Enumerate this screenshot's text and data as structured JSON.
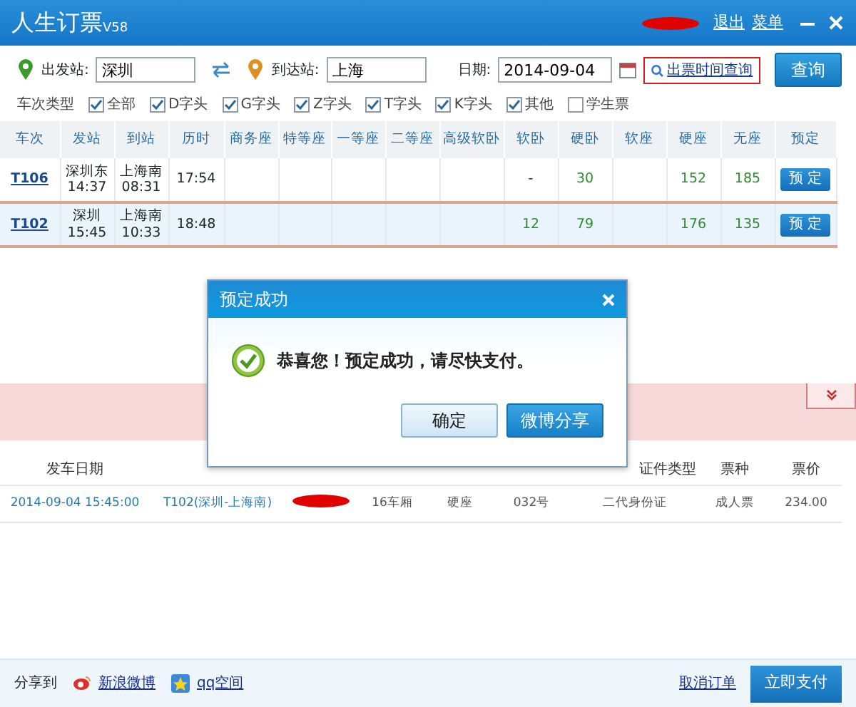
{
  "window": {
    "title": "人生订票",
    "version": "V58",
    "user_redacted": true,
    "links": [
      "退出",
      "菜单"
    ]
  },
  "search": {
    "from_label": "出发站:",
    "from_value": "深圳",
    "to_label": "到达站:",
    "to_value": "上海",
    "date_label": "日期:",
    "date_value": "2014-09-04",
    "time_link": "出票时间查询",
    "button": "查询"
  },
  "filters": {
    "label": "车次类型",
    "items": [
      {
        "label": "全部",
        "checked": true
      },
      {
        "label": "D字头",
        "checked": true
      },
      {
        "label": "G字头",
        "checked": true
      },
      {
        "label": "Z字头",
        "checked": true
      },
      {
        "label": "T字头",
        "checked": true
      },
      {
        "label": "K字头",
        "checked": true
      },
      {
        "label": "其他",
        "checked": true
      },
      {
        "label": "学生票",
        "checked": false
      }
    ]
  },
  "trains": {
    "columns": [
      "车次",
      "发站",
      "到站",
      "历时",
      "商务座",
      "特等座",
      "一等座",
      "二等座",
      "高级软卧",
      "软卧",
      "硬卧",
      "软座",
      "硬座",
      "无座",
      "预定"
    ],
    "rows": [
      {
        "train": "T106",
        "from": "深圳东",
        "depart": "14:37",
        "to": "上海南",
        "arrive": "08:31",
        "duration": "17:54",
        "seats": {
          "soft_sleeper": "-",
          "hard_sleeper": "30",
          "hard_seat": "152",
          "no_seat": "185"
        },
        "book": "预 定",
        "selected": false
      },
      {
        "train": "T102",
        "from": "深圳",
        "depart": "15:45",
        "to": "上海南",
        "arrive": "10:33",
        "duration": "18:48",
        "seats": {
          "soft_sleeper": "12",
          "hard_sleeper": "79",
          "hard_seat": "176",
          "no_seat": "135"
        },
        "book": "预 定",
        "selected": true
      }
    ]
  },
  "orders": {
    "columns": {
      "departure_date": "发车日期",
      "id_type": "证件类型",
      "ticket_type": "票种",
      "price": "票价"
    },
    "rows": [
      {
        "departure_date": "2014-09-04 15:45:00",
        "train": "T102(深圳-上海南)",
        "name_redacted": true,
        "car": "16车厢",
        "seat_class": "硬座",
        "seat_no": "032号",
        "id_type": "二代身份证",
        "ticket_type": "成人票",
        "price": "234.00"
      }
    ]
  },
  "footer": {
    "share_label": "分享到",
    "share_links": [
      "新浪微博",
      "qq空间"
    ],
    "cancel_link": "取消订单",
    "pay_button": "立即支付"
  },
  "dialog": {
    "title": "预定成功",
    "message": "恭喜您！预定成功，请尽快支付。",
    "buttons": [
      {
        "label": "确定",
        "kind": "secondary"
      },
      {
        "label": "微博分享",
        "kind": "primary"
      }
    ]
  }
}
